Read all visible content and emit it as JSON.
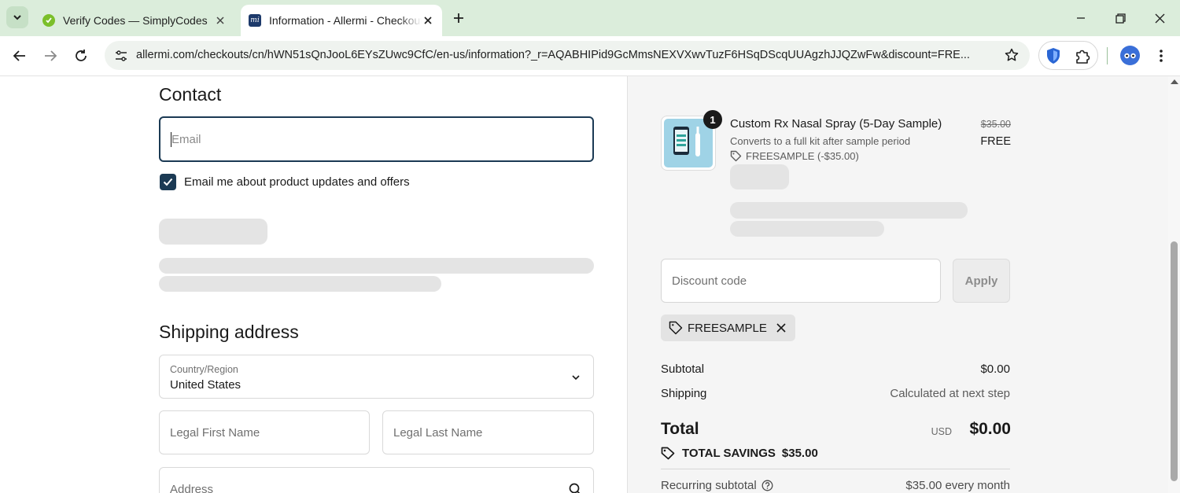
{
  "browser": {
    "tabs": [
      {
        "title": "Verify Codes — SimplyCodes",
        "favicon": "simplycodes-favicon",
        "active": false
      },
      {
        "title": "Information - Allermi - Checkout",
        "favicon": "allermi-favicon",
        "favicon_text": "mi",
        "active": true
      }
    ],
    "url": "allermi.com/checkouts/cn/hWN51sQnJooL6EYsZUwc9CfC/en-us/information?_r=AQABHIPid9GcMmsNEXVXwvTuzF6HSqDScqUUAgzhJJQZwFw&discount=FRE..."
  },
  "contact": {
    "heading": "Contact",
    "email_placeholder": "Email",
    "marketing_label": "Email me about product updates and offers",
    "marketing_checked": true
  },
  "shipping": {
    "heading": "Shipping address",
    "country_label": "Country/Region",
    "country_value": "United States",
    "first_name_placeholder": "Legal First Name",
    "last_name_placeholder": "Legal Last Name",
    "address_placeholder": "Address"
  },
  "order": {
    "item": {
      "quantity": "1",
      "name": "Custom Rx Nasal Spray (5-Day Sample)",
      "description": "Converts to a full kit after sample period",
      "discount_line": "FREESAMPLE (-$35.00)",
      "original_price": "$35.00",
      "price": "FREE"
    },
    "discount_placeholder": "Discount code",
    "apply_label": "Apply",
    "applied_code": "FREESAMPLE",
    "subtotal_label": "Subtotal",
    "subtotal_value": "$0.00",
    "shipping_label": "Shipping",
    "shipping_value": "Calculated at next step",
    "total_label": "Total",
    "currency": "USD",
    "total_value": "$0.00",
    "savings_label": "TOTAL SAVINGS",
    "savings_value": "$35.00",
    "recurring_label": "Recurring subtotal",
    "recurring_value": "$35.00 every month"
  },
  "colors": {
    "tabstrip": "#dbeddb",
    "accent": "#1b3a54",
    "summary_bg": "#f5f5f5",
    "skeleton": "#e4e4e4"
  }
}
